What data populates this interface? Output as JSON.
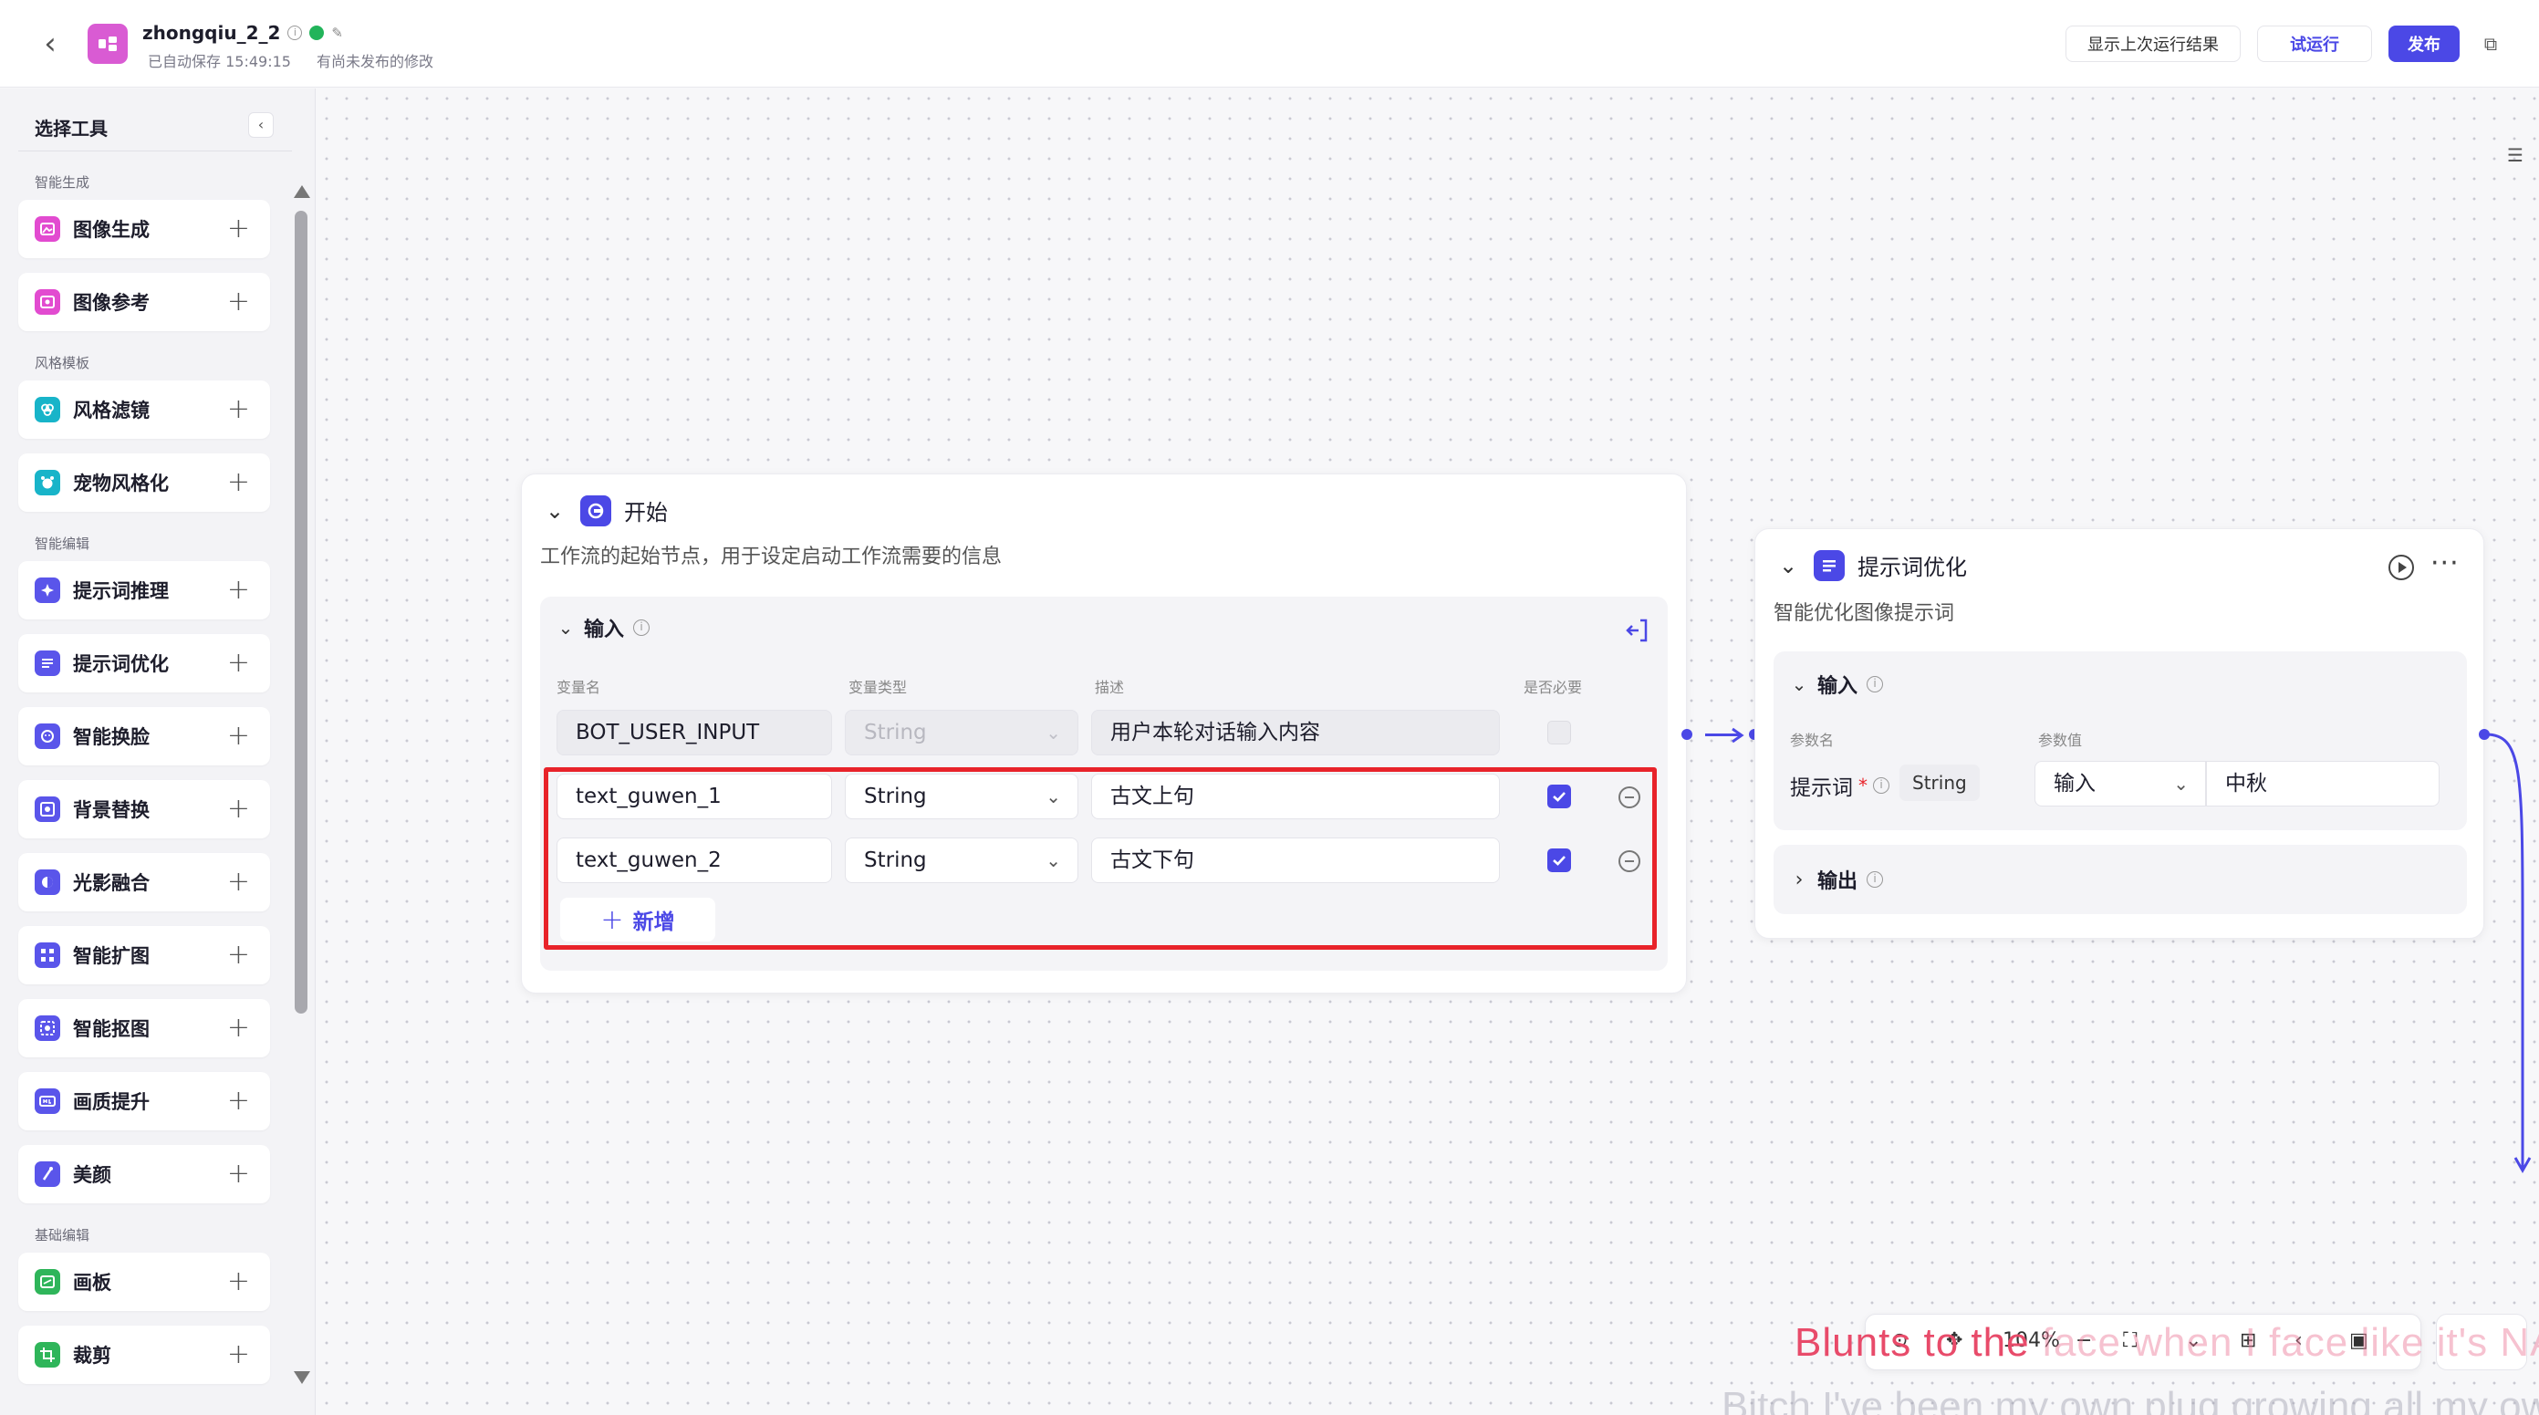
{
  "header": {
    "back_icon": "chevron-left-icon",
    "app_name": "zhongqiu_2_2",
    "autosave": "已自动保存 15:49:15",
    "unpublished": "有尚未发布的修改",
    "btn_show_last": "显示上次运行结果",
    "btn_try_run": "试运行",
    "btn_publish": "发布",
    "accent": "#4b48e6"
  },
  "sidebar": {
    "title": "选择工具",
    "groups": [
      {
        "label": "智能生成",
        "items": [
          {
            "label": "图像生成",
            "icon": "image-gen-icon",
            "color": "#e24bd0"
          },
          {
            "label": "图像参考",
            "icon": "image-ref-icon",
            "color": "#e24bd0"
          }
        ]
      },
      {
        "label": "风格模板",
        "items": [
          {
            "label": "风格滤镜",
            "icon": "filter-icon",
            "color": "#18b4c9"
          },
          {
            "label": "宠物风格化",
            "icon": "pet-icon",
            "color": "#18b4c9"
          }
        ]
      },
      {
        "label": "智能编辑",
        "items": [
          {
            "label": "提示词推理",
            "icon": "prompt-infer-icon",
            "color": "#5a55ea"
          },
          {
            "label": "提示词优化",
            "icon": "prompt-optimize-icon",
            "color": "#5a55ea"
          },
          {
            "label": "智能换脸",
            "icon": "face-swap-icon",
            "color": "#5a55ea"
          },
          {
            "label": "背景替换",
            "icon": "background-icon",
            "color": "#5a55ea"
          },
          {
            "label": "光影融合",
            "icon": "light-icon",
            "color": "#5a55ea"
          },
          {
            "label": "智能扩图",
            "icon": "expand-icon",
            "color": "#5a55ea"
          },
          {
            "label": "智能抠图",
            "icon": "cutout-icon",
            "color": "#5a55ea"
          },
          {
            "label": "画质提升",
            "icon": "hd-icon",
            "color": "#5a55ea"
          },
          {
            "label": "美颜",
            "icon": "beauty-icon",
            "color": "#5a55ea"
          }
        ]
      },
      {
        "label": "基础编辑",
        "items": [
          {
            "label": "画板",
            "icon": "canvas-icon",
            "color": "#2fb55a"
          },
          {
            "label": "裁剪",
            "icon": "crop-icon",
            "color": "#2fb55a"
          }
        ]
      }
    ]
  },
  "start_node": {
    "title": "开始",
    "desc": "工作流的起始节点，用于设定启动工作流需要的信息",
    "section": "输入",
    "col_name": "变量名",
    "col_type": "变量类型",
    "col_desc": "描述",
    "col_required": "是否必要",
    "rows": [
      {
        "name": "BOT_USER_INPUT",
        "type": "String",
        "desc": "用户本轮对话输入内容",
        "required": false
      },
      {
        "name": "text_guwen_1",
        "type": "String",
        "desc": "古文上句",
        "required": true
      },
      {
        "name": "text_guwen_2",
        "type": "String",
        "desc": "古文下句",
        "required": true
      }
    ],
    "add_label": "新增"
  },
  "prompt_node": {
    "title": "提示词优化",
    "desc": "智能优化图像提示词",
    "input_section": "输入",
    "col_param": "参数名",
    "col_value": "参数值",
    "param_name": "提示词",
    "required_mark": "*",
    "param_type": "String",
    "source": "输入",
    "value": "中秋",
    "output_section": "输出"
  },
  "toolbar": {
    "zoom": "104%"
  },
  "captions": {
    "line1_a": "Blunts to the",
    "line1_b": " face when I face like it's NASC",
    "line2": "Bitch I've been my own plug growing all my ow"
  }
}
